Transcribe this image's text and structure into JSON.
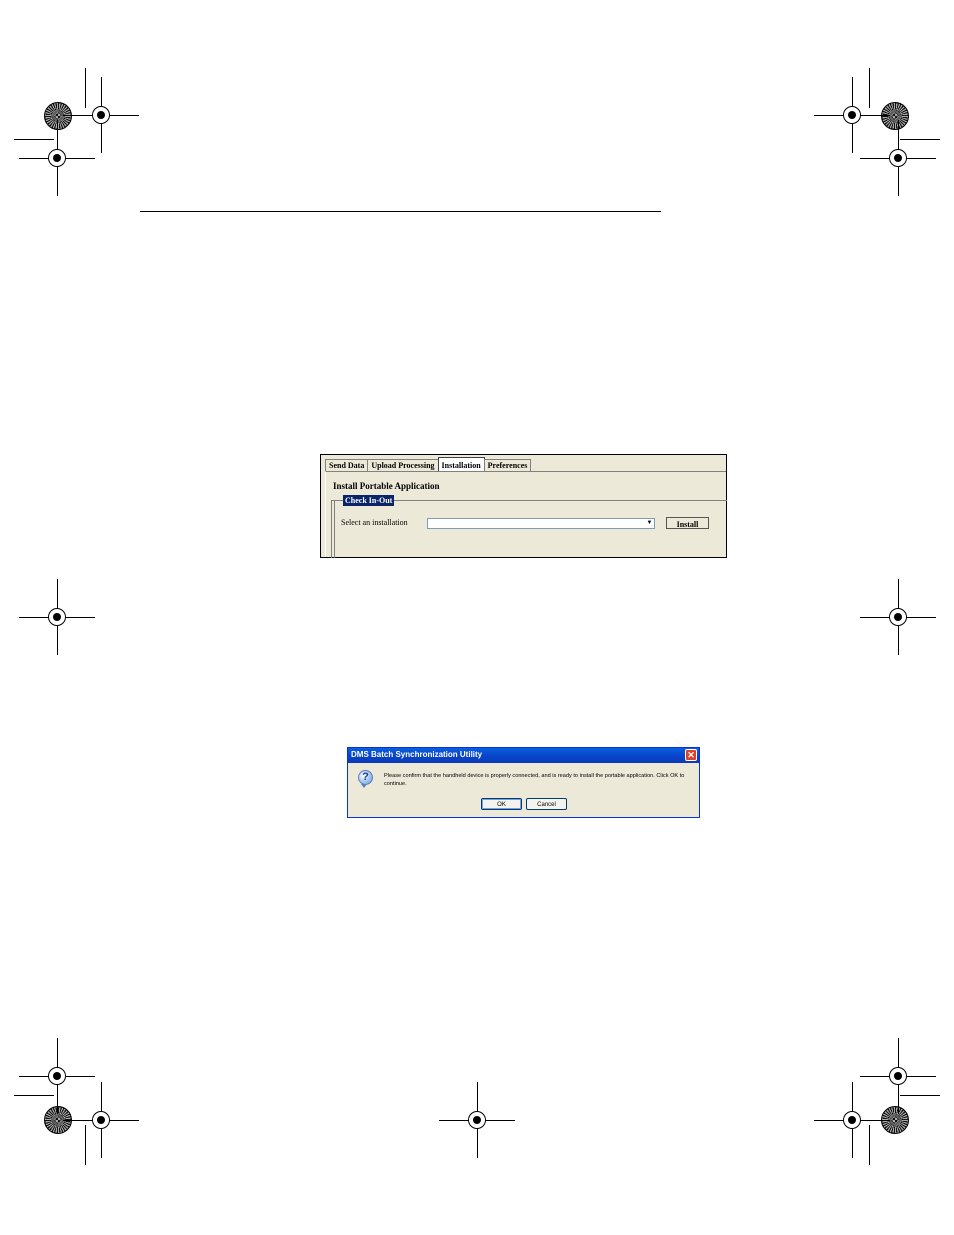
{
  "panel": {
    "tabs": [
      {
        "label": "Send Data"
      },
      {
        "label": "Upload Processing"
      },
      {
        "label": "Installation"
      },
      {
        "label": "Preferences"
      }
    ],
    "active_tab": "Installation",
    "section_title": "Install Portable Application",
    "group_legend": "Check In-Out",
    "select_label": "Select an installation",
    "select_value": "",
    "install_button": "Install",
    "accent_color": "#0a246a"
  },
  "dialog": {
    "title": "DMS Batch Synchronization Utility",
    "message": "Please confirm that the handheld device is properly connected, and is ready to install the portable application. Click OK to continue.",
    "ok_label": "OK",
    "cancel_label": "Cancel",
    "close_glyph": "✕",
    "icon": "question-icon",
    "titlebar_color": "#0842c7"
  }
}
